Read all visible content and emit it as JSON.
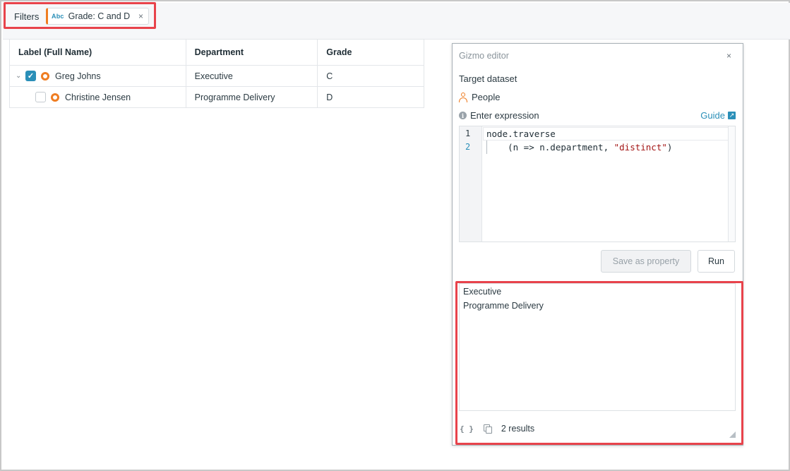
{
  "filter_bar": {
    "label": "Filters",
    "chip": {
      "type_badge": "Abc",
      "text": "Grade: C and D",
      "close": "×"
    }
  },
  "table": {
    "headers": [
      "Label (Full Name)",
      "Department",
      "Grade"
    ],
    "rows": [
      {
        "name": "Greg Johns",
        "department": "Executive",
        "grade": "C",
        "checked": true,
        "expanded": true
      },
      {
        "name": "Christine Jensen",
        "department": "Programme Delivery",
        "grade": "D",
        "checked": false
      }
    ]
  },
  "gizmo_editor": {
    "title": "Gizmo editor",
    "close": "×",
    "target_dataset_label": "Target dataset",
    "dataset": "People",
    "expression_label": "Enter expression",
    "guide_link": "Guide",
    "code": {
      "line_numbers": [
        "1",
        "2"
      ],
      "line1": "node.traverse",
      "line2_prefix": "    (n => n.department, ",
      "line2_string": "\"distinct\"",
      "line2_suffix": ")"
    },
    "save_button": "Save as property",
    "run_button": "Run",
    "results": [
      "Executive",
      "Programme Delivery"
    ],
    "result_count": "2 results"
  },
  "colors": {
    "accent": "#2a8fb8",
    "node_orange": "#ef7d22",
    "highlight_red": "#e8434b"
  }
}
